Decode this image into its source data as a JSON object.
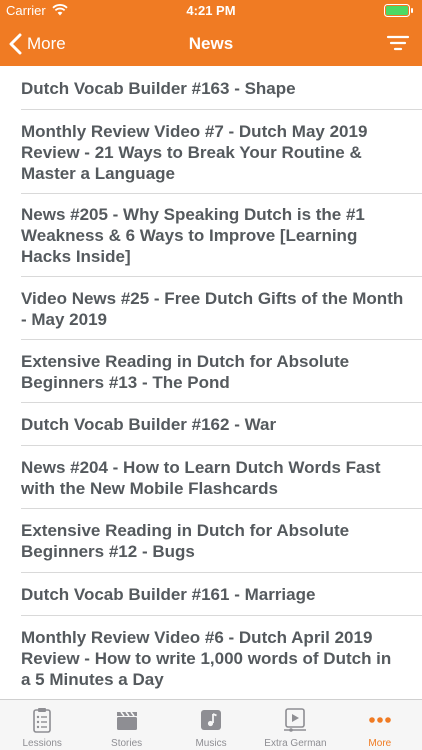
{
  "status_bar": {
    "carrier": "Carrier",
    "time": "4:21 PM",
    "battery_level": 1.0,
    "battery_color": "#4cd964"
  },
  "nav": {
    "back_label": "More",
    "title": "News",
    "color": "#f07b23"
  },
  "news": [
    {
      "title": "Dutch Vocab Builder #163 - Shape"
    },
    {
      "title": "Monthly Review Video #7 - Dutch May 2019 Review - 21 Ways to Break Your Routine & Master a Language"
    },
    {
      "title": "News #205 - Why Speaking Dutch is the #1 Weakness & 6 Ways to Improve [Learning Hacks Inside]"
    },
    {
      "title": "Video News #25 - Free Dutch Gifts of the Month - May 2019"
    },
    {
      "title": "Extensive Reading in Dutch for Absolute Beginners #13 - The Pond"
    },
    {
      "title": "Dutch Vocab Builder #162 - War"
    },
    {
      "title": "News #204 - How to Learn Dutch Words Fast with the New Mobile Flashcards"
    },
    {
      "title": "Extensive Reading in Dutch for Absolute Beginners #12 - Bugs"
    },
    {
      "title": "Dutch Vocab Builder #161 - Marriage"
    },
    {
      "title": "Monthly Review Video #6 - Dutch April 2019 Review - How to write 1,000 words of Dutch in a 5 Minutes a Day"
    }
  ],
  "tabs": [
    {
      "label": "Lessions",
      "icon": "clipboard-icon",
      "active": false
    },
    {
      "label": "Stories",
      "icon": "clapperboard-icon",
      "active": false
    },
    {
      "label": "Musics",
      "icon": "music-note-icon",
      "active": false
    },
    {
      "label": "Extra German",
      "icon": "video-player-icon",
      "active": false
    },
    {
      "label": "More",
      "icon": "more-dots-icon",
      "active": true
    }
  ]
}
